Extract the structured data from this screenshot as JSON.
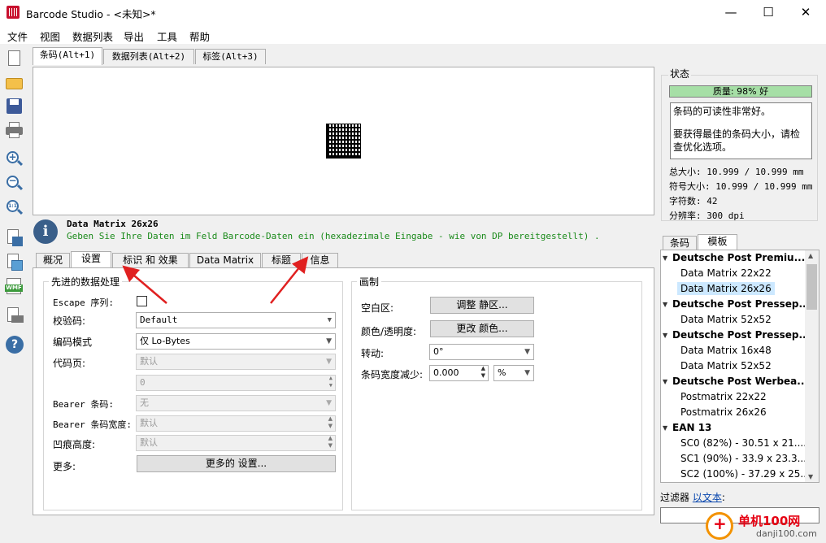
{
  "window": {
    "title": "Barcode Studio - <未知>*",
    "min": "—",
    "max": "☐",
    "close": "✕"
  },
  "menu": [
    "文件",
    "视图",
    "数据列表",
    "导出",
    "工具",
    "帮助"
  ],
  "toolbar": [
    "new-file-icon",
    "open-folder-icon",
    "save-icon",
    "print-icon",
    "zoom-in-icon",
    "zoom-out-icon",
    "zoom-reset-icon",
    "export-image-icon",
    "export-picture-icon",
    "wmf-icon",
    "export-print-icon",
    "help-icon"
  ],
  "toolbar_text": {
    "zoom_reset": "1:1",
    "wmf": "WMF",
    "help": "?"
  },
  "top_tabs": [
    "条码(Alt+1)",
    "数据列表(Alt+2)",
    "标签(Alt+3)"
  ],
  "info": {
    "icon": "i",
    "title": "Data Matrix 26x26",
    "description": "Geben Sie Ihre Daten im Feld Barcode-Daten ein (hexadezimale Eingabe - wie von DP bereitgestellt) ."
  },
  "settings_tabs": [
    "概况",
    "设置",
    "标识 和 效果",
    "Data Matrix",
    "标题",
    "信息"
  ],
  "advanced": {
    "title": "先进的数据处理",
    "escape_label": "Escape 序列:",
    "checksum_label": "校验码:",
    "checksum_value": "Default",
    "encoding_label": "编码模式",
    "encoding_value": "仅 Lo-Bytes",
    "codepage_label": "代码页:",
    "codepage_value": "默认",
    "codepage_num": "0",
    "bearer_label": "Bearer 条码:",
    "bearer_value": "无",
    "bearer_width_label": "Bearer 条码宽度:",
    "bearer_width_value": "默认",
    "notch_label": "凹痕高度:",
    "notch_value": "默认",
    "more_label": "更多:",
    "more_button": "更多的 设置..."
  },
  "drawing": {
    "title": "画制",
    "quiet_label": "空白区:",
    "quiet_button": "调整 静区...",
    "color_label": "颜色/透明度:",
    "color_button": "更改 颜色...",
    "rotate_label": "转动:",
    "rotate_value": "0°",
    "reduce_label": "条码宽度减少:",
    "reduce_value": "0.000",
    "reduce_unit": "%"
  },
  "status": {
    "label": "状态",
    "quality": "质量: 98% 好",
    "message1": "条码的可读性非常好。",
    "message2": "要获得最佳的条码大小，请检查优化选项。",
    "total_size": "总大小: 10.999 / 10.999 mm",
    "symbol_size": "符号大小: 10.999 / 10.999 mm",
    "char_count": "字符数: 42",
    "resolution": "分辨率: 300 dpi"
  },
  "right_tabs": [
    "条码",
    "模板"
  ],
  "templates": [
    {
      "type": "group",
      "text": "Deutsche Post Premiu..."
    },
    {
      "type": "child",
      "text": "Data Matrix 22x22"
    },
    {
      "type": "child",
      "text": "Data Matrix 26x26",
      "selected": true
    },
    {
      "type": "group",
      "text": "Deutsche Post Pressep..."
    },
    {
      "type": "child",
      "text": "Data Matrix 52x52"
    },
    {
      "type": "group",
      "text": "Deutsche Post Pressep..."
    },
    {
      "type": "child",
      "text": "Data Matrix 16x48"
    },
    {
      "type": "child",
      "text": "Data Matrix 52x52"
    },
    {
      "type": "group",
      "text": "Deutsche Post Werbea..."
    },
    {
      "type": "child",
      "text": "Postmatrix 22x22"
    },
    {
      "type": "child",
      "text": "Postmatrix 26x26"
    },
    {
      "type": "group",
      "text": "EAN 13"
    },
    {
      "type": "child",
      "text": "SC0 (82%) - 30.51 x 21...."
    },
    {
      "type": "child",
      "text": "SC1 (90%) - 33.9 x 23.3..."
    },
    {
      "type": "child",
      "text": "SC2 (100%) - 37.29 x 25..."
    }
  ],
  "filter": {
    "label": "过滤器",
    "link": "以文本",
    "colon": ":"
  },
  "watermark": {
    "plus": "+",
    "name": "单机100网",
    "url": "danji100.com"
  },
  "colors": {
    "accent": "#a6dfa6",
    "arrow": "#e02020",
    "link": "#0645ad"
  }
}
